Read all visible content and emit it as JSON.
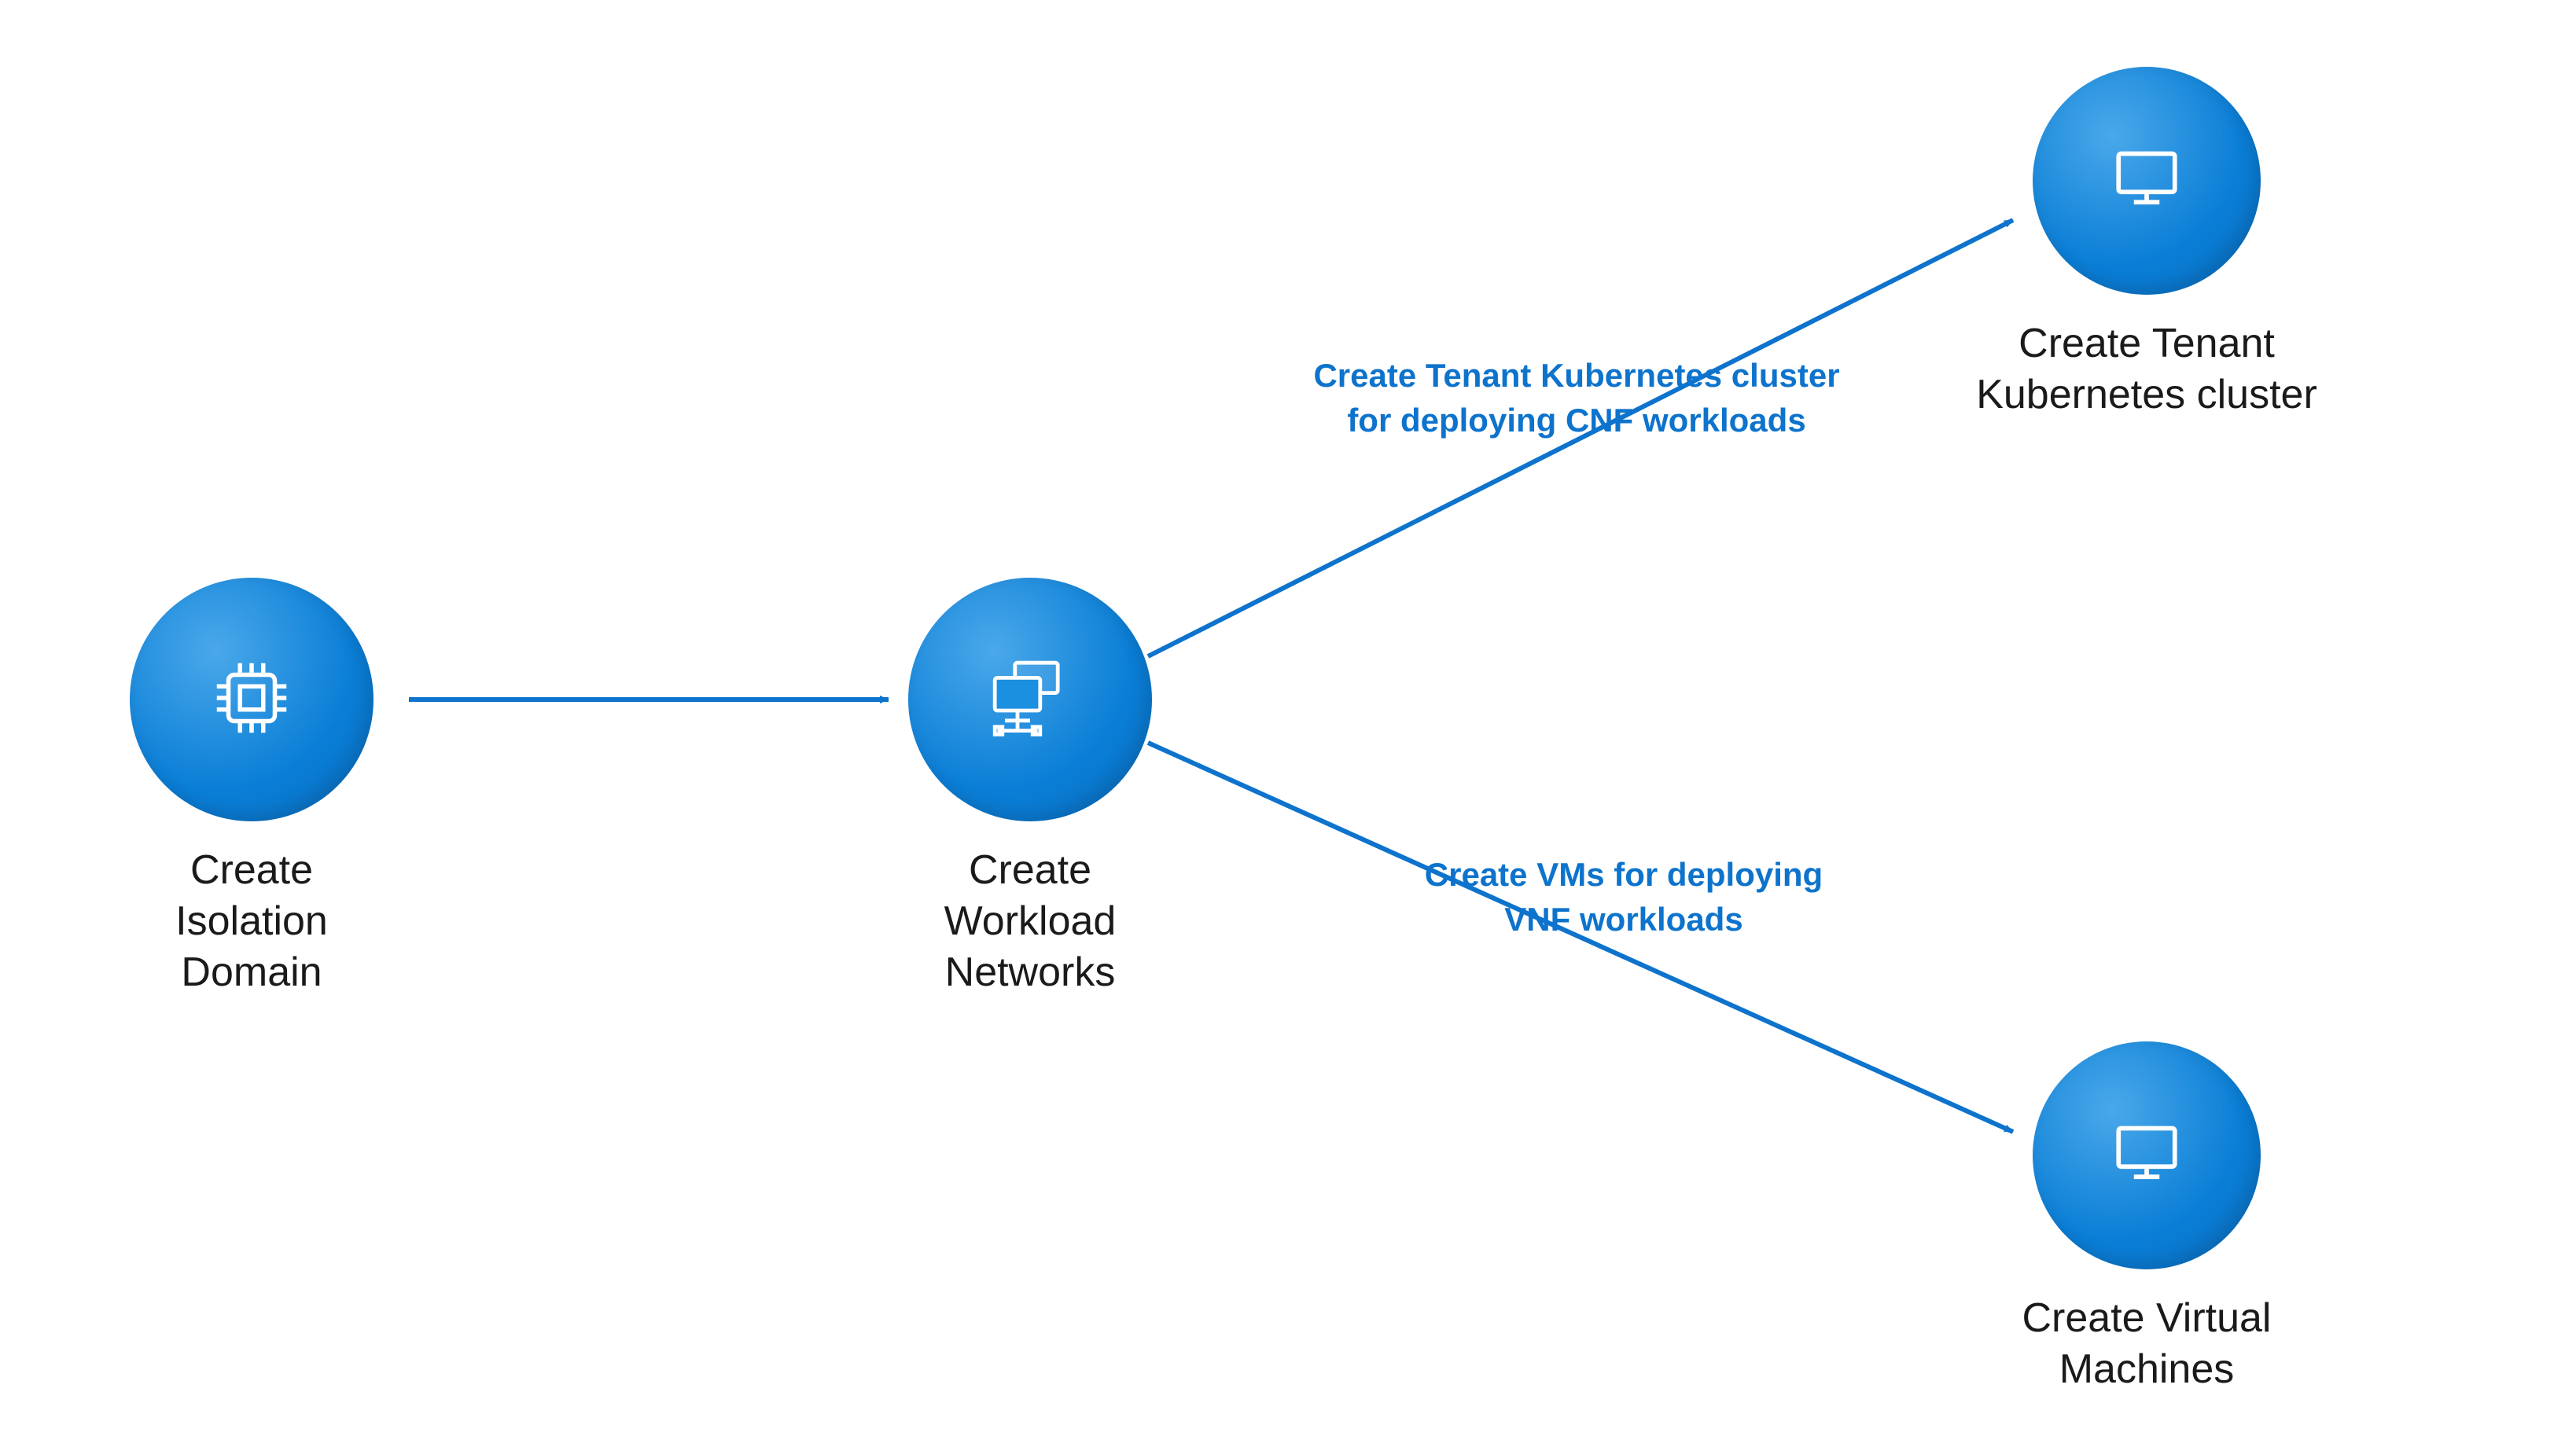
{
  "nodes": {
    "isolation": {
      "label": "Create\nIsolation\nDomain"
    },
    "workload": {
      "label": "Create\nWorkload\nNetworks"
    },
    "kubernetes": {
      "label": "Create Tenant\nKubernetes cluster"
    },
    "vms": {
      "label": "Create Virtual\nMachines"
    }
  },
  "edges": {
    "cnf": {
      "label": "Create Tenant Kubernetes cluster\nfor deploying CNF workloads"
    },
    "vnf": {
      "label": "Create VMs for deploying\nVNF workloads"
    }
  },
  "colors": {
    "node_fill": "#118ee5",
    "arrow": "#0d73cc",
    "text": "#1a1a1a"
  }
}
